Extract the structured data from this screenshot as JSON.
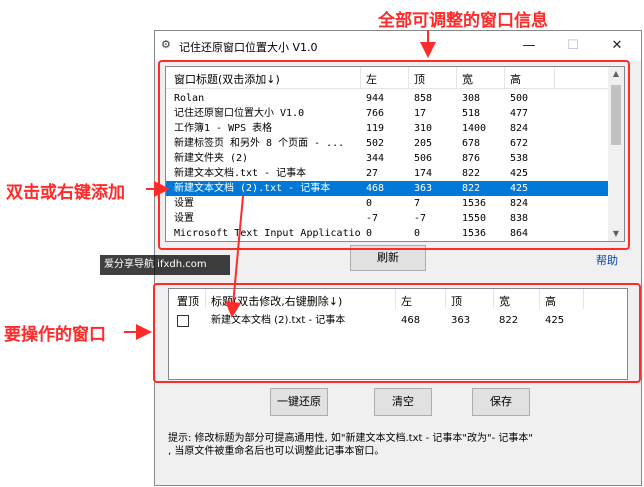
{
  "window": {
    "title": "记住还原窗口位置大小 V1.0",
    "icon": "app-icon",
    "minimize_glyph": "—",
    "maximize_glyph": "☐",
    "close_glyph": "✕"
  },
  "window_list": {
    "headers": [
      "窗口标题(双击添加↓)",
      "左",
      "顶",
      "宽",
      "高"
    ],
    "rows": [
      {
        "title": "Rolan",
        "left": "944",
        "top": "858",
        "width": "308",
        "height": "500"
      },
      {
        "title": "记住还原窗口位置大小 V1.0",
        "left": "766",
        "top": "17",
        "width": "518",
        "height": "477"
      },
      {
        "title": "工作簿1 - WPS 表格",
        "left": "119",
        "top": "310",
        "width": "1400",
        "height": "824"
      },
      {
        "title": "新建标签页 和另外 8 个页面 - ...",
        "left": "502",
        "top": "205",
        "width": "678",
        "height": "672"
      },
      {
        "title": "新建文件夹 (2)",
        "left": "344",
        "top": "506",
        "width": "876",
        "height": "538"
      },
      {
        "title": "新建文本文档.txt - 记事本",
        "left": "27",
        "top": "174",
        "width": "822",
        "height": "425"
      },
      {
        "title": "新建文本文档 (2).txt - 记事本",
        "left": "468",
        "top": "363",
        "width": "822",
        "height": "425",
        "selected": true
      },
      {
        "title": "设置",
        "left": "0",
        "top": "7",
        "width": "1536",
        "height": "824"
      },
      {
        "title": "设置",
        "left": "-7",
        "top": "-7",
        "width": "1550",
        "height": "838"
      },
      {
        "title": "Microsoft Text Input Application",
        "left": "0",
        "top": "0",
        "width": "1536",
        "height": "864"
      }
    ]
  },
  "buttons": {
    "refresh": "刷新",
    "help": "帮助",
    "restore_all": "一键还原",
    "clear": "清空",
    "save": "保存"
  },
  "keep_list": {
    "headers": [
      "置顶",
      "标题(双击修改,右键删除↓)",
      "左",
      "顶",
      "宽",
      "高"
    ],
    "rows": [
      {
        "pinned": false,
        "title": "新建文本文档 (2).txt - 记事本",
        "left": "468",
        "top": "363",
        "width": "822",
        "height": "425"
      }
    ]
  },
  "tip": {
    "line1": "提示: 修改标题为部分可提高通用性, 如\"新建文本文档.txt - 记事本\"改为\"- 记事本\"",
    "line2": ", 当原文件被重命名后也可以调整此记事本窗口。"
  },
  "annotations": {
    "top": "全部可调整的窗口信息",
    "left": "双击或右键添加",
    "bottom": "要操作的窗口",
    "color": "#ff2a2a"
  },
  "watermark": "爱分享导航 ifxdh.com"
}
